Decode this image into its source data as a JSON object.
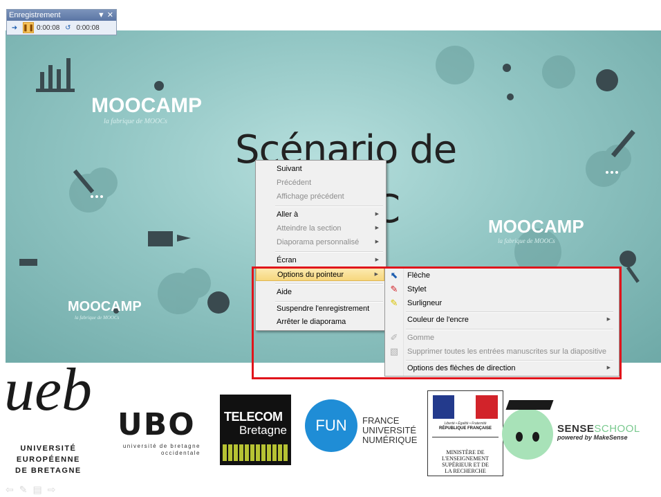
{
  "recorder": {
    "title": "Enregistrement",
    "elapsed_slide": "0:00:08",
    "elapsed_total": "0:00:08"
  },
  "slide": {
    "title_line1": "Scénario de",
    "title_line2": "C",
    "brand": "MOOCAMP",
    "brand_tagline": "la fabrique de MOOCs"
  },
  "context_menu": {
    "items": [
      {
        "label": "Suivant",
        "enabled": true
      },
      {
        "label": "Précédent",
        "enabled": false
      },
      {
        "label": "Affichage précédent",
        "enabled": false
      },
      {
        "label": "Aller à",
        "enabled": true,
        "submenu": true
      },
      {
        "label": "Atteindre la section",
        "enabled": false,
        "submenu": true
      },
      {
        "label": "Diaporama personnalisé",
        "enabled": false,
        "submenu": true
      },
      {
        "label": "Écran",
        "enabled": true,
        "submenu": true
      },
      {
        "label": "Options du pointeur",
        "enabled": true,
        "submenu": true,
        "highlighted": true
      },
      {
        "label": "Aide",
        "enabled": true
      },
      {
        "label": "Suspendre l'enregistrement",
        "enabled": true
      },
      {
        "label": "Arrêter le diaporama",
        "enabled": true
      }
    ]
  },
  "pointer_submenu": {
    "items": [
      {
        "label": "Flèche",
        "icon": "arrow-pointer-icon",
        "enabled": true
      },
      {
        "label": "Stylet",
        "icon": "pen-icon",
        "enabled": true
      },
      {
        "label": "Surligneur",
        "icon": "highlighter-icon",
        "enabled": true
      },
      {
        "label": "Couleur de l'encre",
        "enabled": true,
        "submenu": true
      },
      {
        "label": "Gomme",
        "icon": "eraser-icon",
        "enabled": false
      },
      {
        "label": "Supprimer toutes les entrées manuscrites sur la diapositive",
        "icon": "erase-all-icon",
        "enabled": false
      },
      {
        "label": "Options des flèches de direction",
        "enabled": true,
        "submenu": true
      }
    ]
  },
  "logos": {
    "ueb_mark": "ueb",
    "ueb_lines": [
      "UNIVERSITÉ",
      "EUROPÉENNE",
      "DE BRETAGNE"
    ],
    "ubo_mark": "UBO",
    "ubo_lines": [
      "université de bretagne",
      "occidentale"
    ],
    "telecom_line1": "TELECOM",
    "telecom_line2": "Bretagne",
    "fun_mark": "FUN",
    "fun_lines": [
      "FRANCE",
      "UNIVERSITÉ",
      "NUMÉRIQUE"
    ],
    "republic_motto": "Liberté • Égalité • Fraternité",
    "republic_name": "RÉPUBLIQUE FRANÇAISE",
    "ministry_lines": [
      "MINISTÈRE DE",
      "L'ENSEIGNEMENT",
      "SUPÉRIEUR ET DE",
      "LA RECHERCHE"
    ],
    "sense_brand_a": "SENSE",
    "sense_brand_b": "SCHOOL",
    "sense_tagline": "powered by MakeSense"
  },
  "colors": {
    "slide_bg": "#92c6c4",
    "menu_highlight": "#f6d77e",
    "red_frame": "#e0141b",
    "fun_blue": "#1f8dd6",
    "sense_green": "#79c98e"
  }
}
